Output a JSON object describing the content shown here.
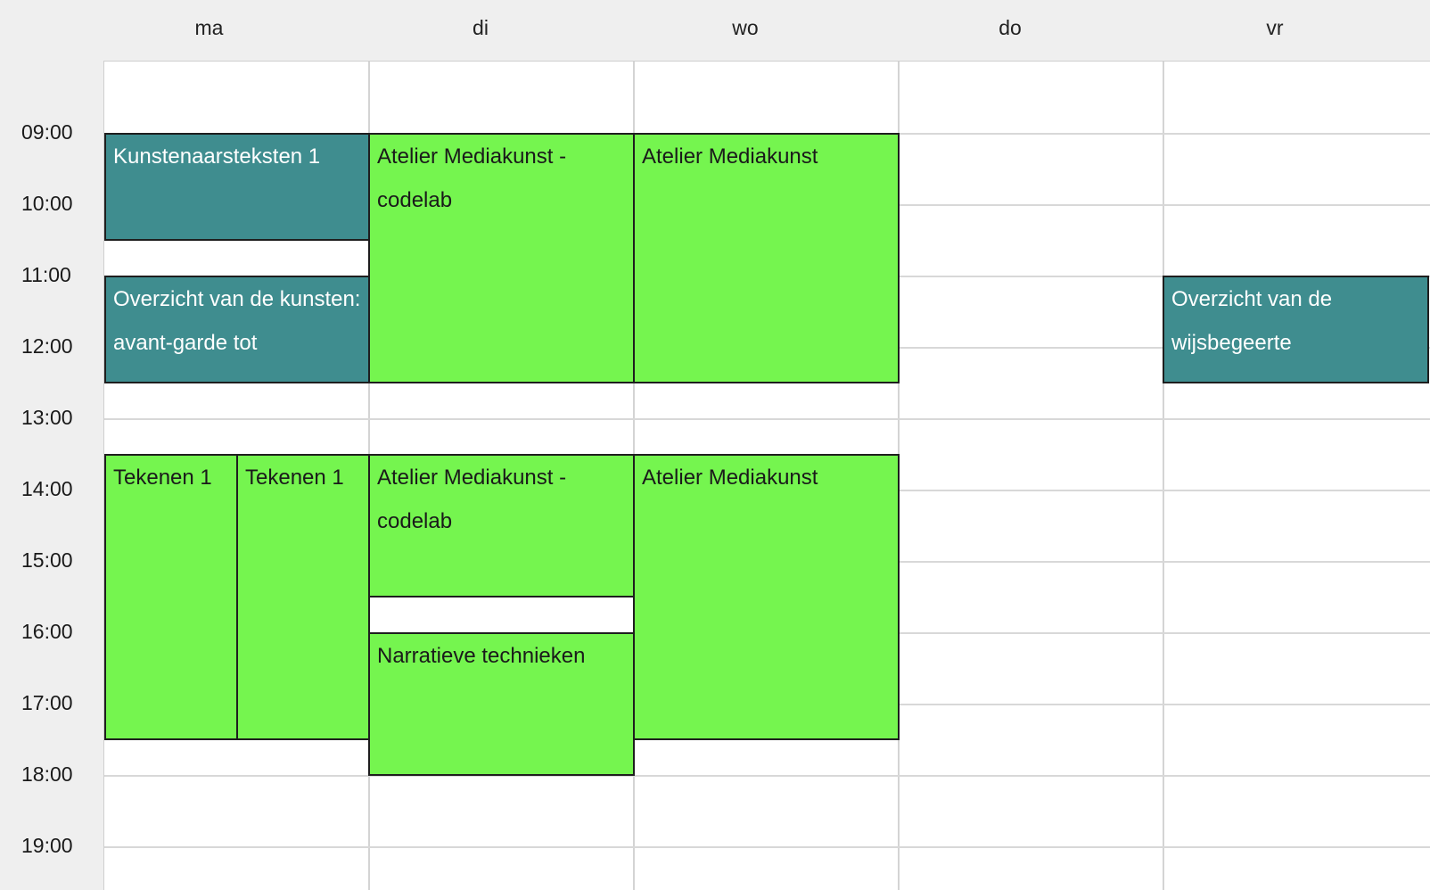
{
  "days": [
    "ma",
    "di",
    "wo",
    "do",
    "vr"
  ],
  "times": [
    "09:00",
    "10:00",
    "11:00",
    "12:00",
    "13:00",
    "14:00",
    "15:00",
    "16:00",
    "17:00",
    "18:00",
    "19:00"
  ],
  "colors": {
    "teal": "#3f8d8f",
    "green": "#75f54f",
    "grid_line": "#d4d4d4",
    "header_bg": "#efefef"
  },
  "events": [
    {
      "title": "Kunstenaarsteksten 1",
      "day": "ma",
      "color": "teal"
    },
    {
      "title": "Overzicht van de kunsten: avant-garde tot",
      "day": "ma",
      "color": "teal"
    },
    {
      "title": "Tekenen 1",
      "day": "ma",
      "color": "green"
    },
    {
      "title": "Tekenen 1",
      "day": "ma",
      "color": "green"
    },
    {
      "title": "Atelier Mediakunst - codelab",
      "day": "di",
      "color": "green"
    },
    {
      "title": "Atelier Mediakunst - codelab",
      "day": "di",
      "color": "green"
    },
    {
      "title": "Narratieve technieken",
      "day": "di",
      "color": "green"
    },
    {
      "title": "Atelier Mediakunst",
      "day": "wo",
      "color": "green"
    },
    {
      "title": "Atelier Mediakunst",
      "day": "wo",
      "color": "green"
    },
    {
      "title": "Overzicht van de wijsbegeerte",
      "day": "vr",
      "color": "teal"
    }
  ]
}
